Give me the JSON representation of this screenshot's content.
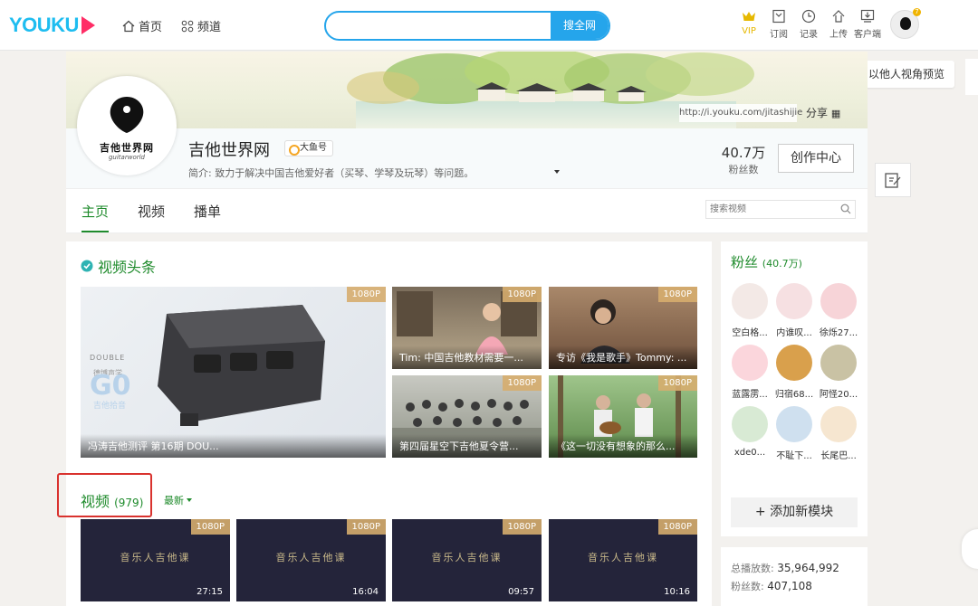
{
  "header": {
    "logo": "YOUKU",
    "nav": [
      {
        "label": "首页",
        "icon": "home-icon"
      },
      {
        "label": "频道",
        "icon": "grid-icon"
      }
    ],
    "search_value": "",
    "search_button": "搜全网",
    "icons": [
      {
        "label": "VIP",
        "icon": "crown-icon"
      },
      {
        "label": "订阅",
        "icon": "bookmark-icon"
      },
      {
        "label": "记录",
        "icon": "clock-icon"
      },
      {
        "label": "上传",
        "icon": "upload-icon"
      },
      {
        "label": "客户端",
        "icon": "download-icon"
      }
    ],
    "notification_count": "7"
  },
  "preview_button": "以他人视角预览",
  "channel": {
    "avatar_text": "吉他世界网",
    "avatar_sub": "guitarworld",
    "name": "吉他世界网",
    "tag": "大鱼号",
    "intro": "简介: 致力于解决中国吉他爱好者（买琴、学琴及玩琴）等问题。",
    "url": "http://i.youku.com/jitashijie",
    "share": "分享",
    "fans_count": "40.7万",
    "fans_label": "粉丝数",
    "create_button": "创作中心"
  },
  "tabs": {
    "items": [
      "主页",
      "视频",
      "播单"
    ],
    "active": 0,
    "search_placeholder": "搜索视频"
  },
  "headline": {
    "title": "视频头条",
    "big": {
      "res": "1080P",
      "caption": "冯涛吉他测评 第16期 DOU...",
      "product_brand": "DOUBLE",
      "product_sub": "德博声学",
      "product_model": "G0",
      "product_model_sub": "吉他拾音"
    },
    "items": [
      {
        "res": "1080P",
        "caption": "Tim: 中国吉他教材需要一..."
      },
      {
        "res": "1080P",
        "caption": "专访《我是歌手》Tommy: ..."
      },
      {
        "res": "1080P",
        "caption": "第四届星空下吉他夏令营..."
      },
      {
        "res": "1080P",
        "caption": "《这一切没有想象的那么..."
      }
    ]
  },
  "videos": {
    "title": "视频",
    "count": "(979)",
    "sort": "最新",
    "items": [
      {
        "res": "1080P",
        "duration": "27:15",
        "thumb_title": "音乐人吉他课"
      },
      {
        "res": "1080P",
        "duration": "16:04",
        "thumb_title": "音乐人吉他课"
      },
      {
        "res": "1080P",
        "duration": "09:57",
        "thumb_title": "音乐人吉他课"
      },
      {
        "res": "1080P",
        "duration": "10:16",
        "thumb_title": "音乐人吉他课"
      }
    ]
  },
  "fans": {
    "title": "粉丝",
    "count": "(40.7万)",
    "items": [
      {
        "name": "空白格...",
        "color": "#f3e9e6"
      },
      {
        "name": "内谁叹...",
        "color": "#f6e0e2"
      },
      {
        "name": "徐烁27...",
        "color": "#f7d4d8"
      },
      {
        "name": "蓝露雳...",
        "color": "#fbd6dc"
      },
      {
        "name": "归宿68...",
        "color": "#d9a04c"
      },
      {
        "name": "阿怪20...",
        "color": "#c9c2a4"
      },
      {
        "name": "xde0...",
        "color": "#d8ead4"
      },
      {
        "name": "不耻下...",
        "color": "#cfe0ef"
      },
      {
        "name": "长尾巴...",
        "color": "#f6e6d0"
      }
    ],
    "add_module": "+ 添加新模块"
  },
  "stats": [
    {
      "label": "总播放数:",
      "value": "35,964,992"
    },
    {
      "label": "粉丝数:",
      "value": "407,108"
    }
  ],
  "colors": {
    "accent_green": "#1f8b2c",
    "search_blue": "#25a5eb",
    "highlight_red": "#d9322e",
    "res_badge": "#d6ad6e"
  }
}
